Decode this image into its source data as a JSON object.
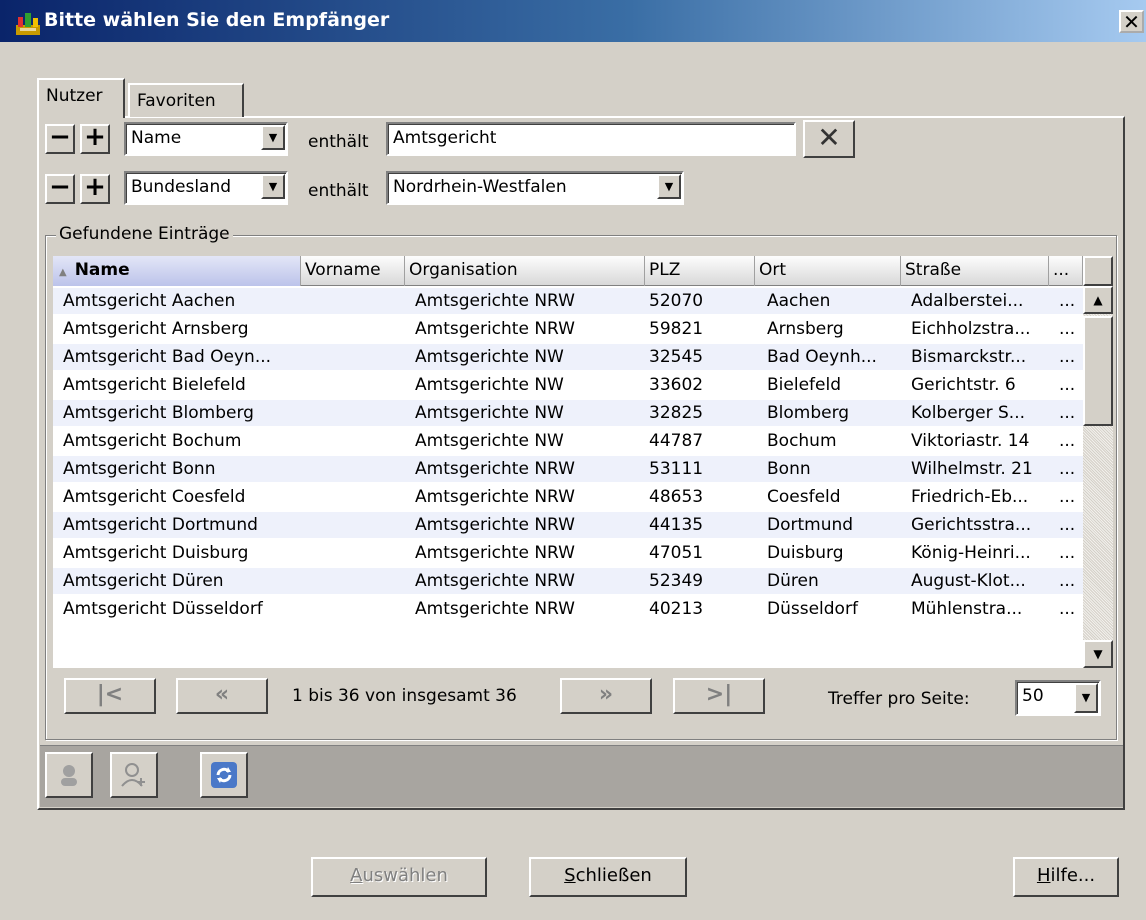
{
  "window": {
    "title": "Bitte wählen Sie den Empfänger",
    "close_glyph": "✕"
  },
  "tabs": [
    {
      "label": "Nutzer",
      "active": true
    },
    {
      "label": "Favoriten",
      "active": false
    }
  ],
  "filters": [
    {
      "field": "Name",
      "operator": "enthält",
      "value": "Amtsgericht",
      "value_type": "text"
    },
    {
      "field": "Bundesland",
      "operator": "enthält",
      "value": "Nordrhein-Westfalen",
      "value_type": "select"
    }
  ],
  "clear_glyph": "✕",
  "group": {
    "title": "Gefundene Einträge"
  },
  "table": {
    "columns": [
      "Name",
      "Vorname",
      "Organisation",
      "PLZ",
      "Ort",
      "Straße",
      "..."
    ],
    "sorted_column": "Name",
    "rows": [
      [
        "Amtsgericht Aachen",
        "",
        "Amtsgerichte NRW",
        "52070",
        "Aachen",
        "Adalberstei...",
        "..."
      ],
      [
        "Amtsgericht Arnsberg",
        "",
        "Amtsgerichte NRW",
        "59821",
        "Arnsberg",
        "Eichholzstra...",
        "..."
      ],
      [
        "Amtsgericht Bad Oeyn...",
        "",
        "Amtsgerichte NW",
        "32545",
        "Bad Oeynh...",
        "Bismarckstr...",
        "..."
      ],
      [
        "Amtsgericht Bielefeld",
        "",
        "Amtsgerichte NW",
        "33602",
        "Bielefeld",
        "Gerichtstr. 6",
        "..."
      ],
      [
        "Amtsgericht Blomberg",
        "",
        "Amtsgerichte NW",
        "32825",
        "Blomberg",
        "Kolberger S...",
        "..."
      ],
      [
        "Amtsgericht Bochum",
        "",
        "Amtsgerichte NW",
        "44787",
        "Bochum",
        "Viktoriastr. 14",
        "..."
      ],
      [
        "Amtsgericht Bonn",
        "",
        "Amtsgerichte NRW",
        "53111",
        "Bonn",
        "Wilhelmstr. 21",
        "..."
      ],
      [
        "Amtsgericht Coesfeld",
        "",
        "Amtsgerichte NRW",
        "48653",
        "Coesfeld",
        "Friedrich-Eb...",
        "..."
      ],
      [
        "Amtsgericht Dortmund",
        "",
        "Amtsgerichte NRW",
        "44135",
        "Dortmund",
        "Gerichtsstra...",
        "..."
      ],
      [
        "Amtsgericht Duisburg",
        "",
        "Amtsgerichte NRW",
        "47051",
        "Duisburg",
        "König-Heinri...",
        "..."
      ],
      [
        "Amtsgericht Düren",
        "",
        "Amtsgerichte NRW",
        "52349",
        "Düren",
        "August-Klot...",
        "..."
      ],
      [
        "Amtsgericht Düsseldorf",
        "",
        "Amtsgerichte NRW",
        "40213",
        "Düsseldorf",
        "Mühlenstra...",
        "..."
      ]
    ]
  },
  "pager": {
    "info": "1 bis 36 von insgesamt 36",
    "first_glyph": "|<",
    "prev_glyph": "«",
    "next_glyph": "»",
    "last_glyph": ">|",
    "per_page_label": "Treffer pro Seite:",
    "per_page_value": "50"
  },
  "buttons": {
    "select": {
      "accel": "A",
      "rest": "uswählen",
      "enabled": false
    },
    "close": {
      "accel": "S",
      "rest": "chließen",
      "enabled": true
    },
    "help": {
      "accel": "H",
      "rest": "ilfe...",
      "enabled": true
    }
  },
  "icons": {
    "app": "app-icon",
    "toolbar": [
      "user-details-icon",
      "add-user-icon",
      "refresh-icon"
    ]
  },
  "colors": {
    "title_start": "#0a246a",
    "title_end": "#a6caf0",
    "face": "#d4d0c8",
    "row_alt": "#eef1fb",
    "header_sorted": "#bcc3ea",
    "toolbar": "#a8a5a0"
  }
}
